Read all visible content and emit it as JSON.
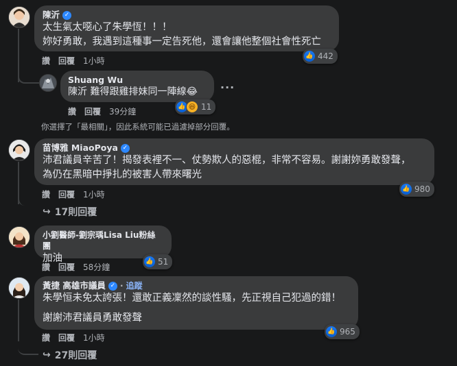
{
  "comments": [
    {
      "author": "陳沂",
      "text": "太生氣太噁心了朱學恆！！！\n妳好勇敢，我遇到這種事一定告死他，還會讓他整個社會性死亡",
      "reply": "讚",
      "comment": "回覆",
      "time": "1小時",
      "reaction_count": "442"
    },
    {
      "author": "Shuang Wu",
      "text": "陳沂 難得跟雞排妹同一陣線😂",
      "reply": "讚",
      "comment": "回覆",
      "time": "39分鐘",
      "reaction_count": "11"
    },
    {
      "author": "苗博雅 MiaoPoya",
      "text": "沛君議員辛苦了！揭發表裡不一、仗勢欺人的惡棍，非常不容易。謝謝妳勇敢發聲，\n為仍在黑暗中掙扎的被害人帶來曙光",
      "reply": "讚",
      "comment": "回覆",
      "time": "1小時",
      "reaction_count": "980",
      "replies_label": "17則回覆"
    },
    {
      "author": "小劉醫師-劉宗瑀Lisa Liu粉絲團",
      "text": "加油",
      "reply": "讚",
      "comment": "回覆",
      "time": "58分鐘",
      "reaction_count": "51"
    },
    {
      "author": "黃捷 高雄市議員",
      "follow": "追蹤",
      "text": "朱學恒未免太誇張！還敢正義凜然的談性騷，先正視自己犯過的錯！",
      "text2": "謝謝沛君議員勇敢發聲",
      "reply": "讚",
      "comment": "回覆",
      "time": "1小時",
      "reaction_count": "965",
      "replies_label": "27則回覆"
    }
  ],
  "filter_notice": "你選擇了「最相關」，因此系統可能已過濾掉部分回覆。",
  "icons": {
    "verified": "verified-badge-icon",
    "like": "like-reaction-icon",
    "haha": "haha-reaction-icon",
    "reply_arrow": "reply-arrow-icon",
    "more": "more-options-icon"
  },
  "colors": {
    "background": "#18191a",
    "bubble": "#3a3b3c",
    "accent": "#2d88ff"
  }
}
